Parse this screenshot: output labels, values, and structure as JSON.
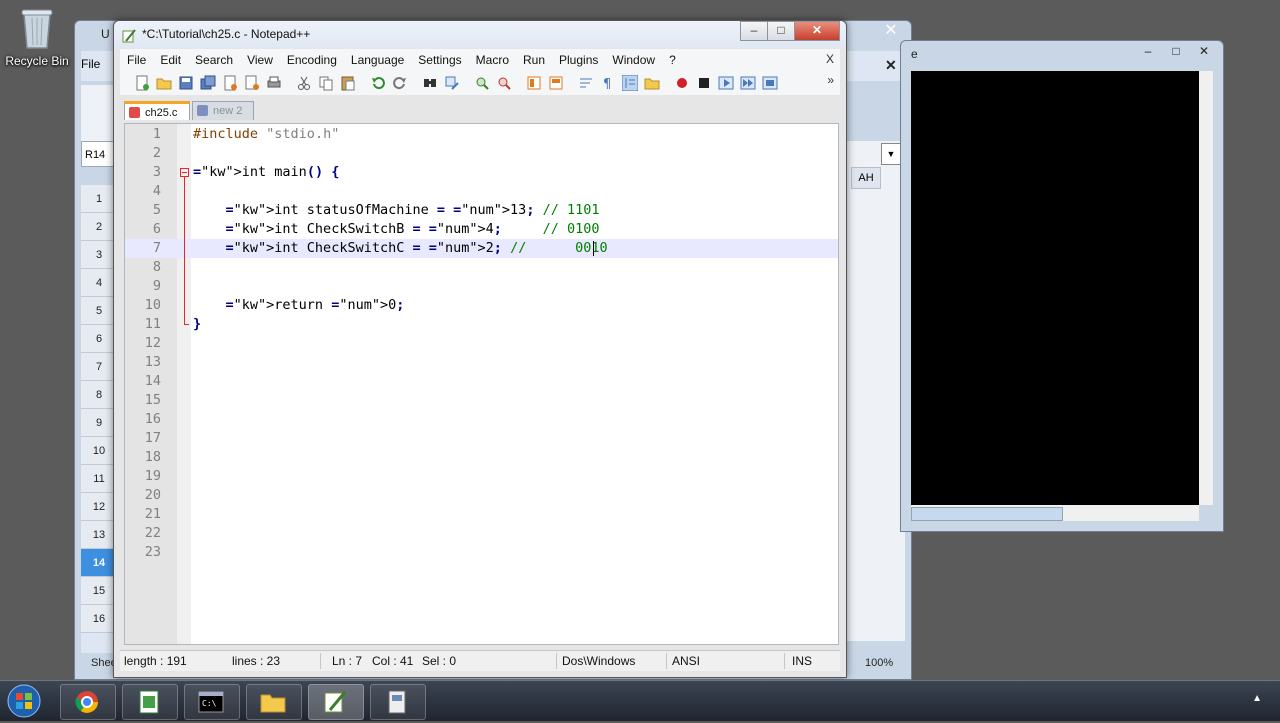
{
  "desktop": {
    "recycle_bin_label": "Recycle Bin"
  },
  "spreadsheet": {
    "title": "U",
    "file_menu": "File",
    "cell_ref": "R14",
    "column_label": "AH",
    "rows": [
      "1",
      "2",
      "3",
      "4",
      "5",
      "6",
      "7",
      "8",
      "9",
      "10",
      "11",
      "12",
      "13",
      "14",
      "15",
      "16"
    ],
    "selected_row": "14",
    "sheet_tab": "Shee",
    "zoom": "100%",
    "close_glyph": "✕",
    "close2_glyph": "✕"
  },
  "console": {
    "title": "e",
    "min": "–",
    "max": "□",
    "close": "✕"
  },
  "npp": {
    "title": "*C:\\Tutorial\\ch25.c - Notepad++",
    "controls": {
      "min": "–",
      "max": "□",
      "close": "✕"
    },
    "menu": [
      "File",
      "Edit",
      "Search",
      "View",
      "Encoding",
      "Language",
      "Settings",
      "Macro",
      "Run",
      "Plugins",
      "Window",
      "?"
    ],
    "menu_close": "X",
    "toolbar_more": "»",
    "tabs": [
      {
        "label": "ch25.c",
        "active": true
      },
      {
        "label": "new  2",
        "active": false
      }
    ],
    "code_lines": [
      {
        "n": "1",
        "text": "#include \"stdio.h\""
      },
      {
        "n": "2",
        "text": ""
      },
      {
        "n": "3",
        "text": "int main() {"
      },
      {
        "n": "4",
        "text": ""
      },
      {
        "n": "5",
        "text": "    int statusOfMachine = 13; // 1101"
      },
      {
        "n": "6",
        "text": "    int CheckSwitchB = 4;     // 0100"
      },
      {
        "n": "7",
        "text": "    int CheckSwitchC = 2; //      0010"
      },
      {
        "n": "8",
        "text": ""
      },
      {
        "n": "9",
        "text": ""
      },
      {
        "n": "10",
        "text": "    return 0;"
      },
      {
        "n": "11",
        "text": "}"
      },
      {
        "n": "12",
        "text": ""
      },
      {
        "n": "13",
        "text": ""
      },
      {
        "n": "14",
        "text": ""
      },
      {
        "n": "15",
        "text": ""
      },
      {
        "n": "16",
        "text": ""
      },
      {
        "n": "17",
        "text": ""
      },
      {
        "n": "18",
        "text": ""
      },
      {
        "n": "19",
        "text": ""
      },
      {
        "n": "20",
        "text": ""
      },
      {
        "n": "21",
        "text": ""
      },
      {
        "n": "22",
        "text": ""
      },
      {
        "n": "23",
        "text": ""
      }
    ],
    "current_line": "7",
    "status": {
      "length": "length : 191",
      "lines": "lines : 23",
      "ln": "Ln : 7",
      "col": "Col : 41",
      "sel": "Sel : 0",
      "eol": "Dos\\Windows",
      "encoding": "ANSI",
      "mode": "INS"
    }
  },
  "colors": {
    "keyword": "#0000ff",
    "number": "#ff8000",
    "comment": "#008000",
    "string": "#808080",
    "preprocessor": "#804000",
    "current_line_bg": "#e8e8ff"
  }
}
